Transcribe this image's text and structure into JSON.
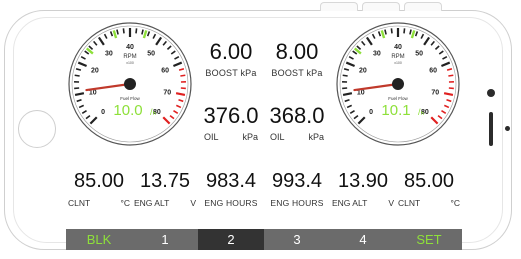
{
  "gauges": [
    {
      "title": "RPM",
      "subtitle": "x100",
      "fuel_label": "Fuel Flow",
      "fuel_value": "10.0",
      "fuel_unit": "/ₕ",
      "ticks": [
        "0",
        "10",
        "20",
        "30",
        "40",
        "50",
        "60",
        "70",
        "80"
      ],
      "needle_rpm": 11
    },
    {
      "title": "RPM",
      "subtitle": "x100",
      "fuel_label": "Fuel Flow",
      "fuel_value": "10.1",
      "fuel_unit": "/ₕ",
      "ticks": [
        "0",
        "10",
        "20",
        "30",
        "40",
        "50",
        "60",
        "70",
        "80"
      ],
      "needle_rpm": 11
    }
  ],
  "center": {
    "boost_left": {
      "value": "6.00",
      "label": "BOOST kPa"
    },
    "boost_right": {
      "value": "8.00",
      "label": "BOOST kPa"
    },
    "oil_left": {
      "value": "376.0",
      "label_left": "OIL",
      "label_right": "kPa"
    },
    "oil_right": {
      "value": "368.0",
      "label_left": "OIL",
      "label_right": "kPa"
    }
  },
  "bottom": [
    {
      "value": "85.00",
      "label_left": "CLNT",
      "label_right": "°C"
    },
    {
      "value": "13.75",
      "label_left": "ENG ALT",
      "label_right": "V"
    },
    {
      "value": "983.4",
      "label": "ENG HOURS"
    },
    {
      "value": "993.4",
      "label": "ENG HOURS"
    },
    {
      "value": "13.90",
      "label_left": "ENG ALT",
      "label_right": "V"
    },
    {
      "value": "85.00",
      "label_left": "CLNT",
      "label_right": "°C"
    }
  ],
  "nav": [
    {
      "label": "BLK",
      "green": true,
      "active": false
    },
    {
      "label": "1",
      "green": false,
      "active": false
    },
    {
      "label": "2",
      "green": false,
      "active": true
    },
    {
      "label": "3",
      "green": false,
      "active": false
    },
    {
      "label": "4",
      "green": false,
      "active": false
    },
    {
      "label": "SET",
      "green": true,
      "active": false
    }
  ],
  "colors": {
    "green": "#8ee03a",
    "red": "#e02020",
    "needle": "#c0392b",
    "nav_bg": "#6b6b6b",
    "nav_active": "#333333"
  }
}
